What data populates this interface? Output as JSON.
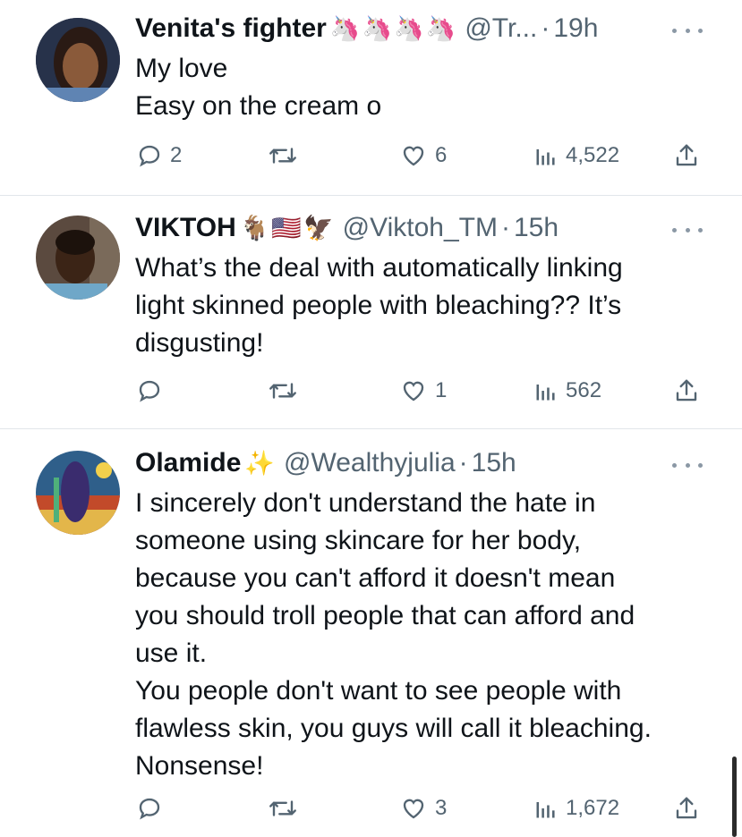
{
  "tweets": [
    {
      "name": "Venita's fighter",
      "emoji": "🦄🦄🦄🦄",
      "handle": "@Tr...",
      "time": "19h",
      "lines": [
        "My love",
        "Easy on the cream o"
      ],
      "replies": "2",
      "retweets": "",
      "likes": "6",
      "views": "4,522"
    },
    {
      "name": "VIKTOH",
      "emoji": "🐐🇺🇸🦅",
      "handle": "@Viktoh_TM",
      "time": "15h",
      "lines": [
        "What’s the deal with automatically linking",
        "light skinned people with bleaching??  It’s",
        "disgusting!"
      ],
      "replies": "",
      "retweets": "",
      "likes": "1",
      "views": "562"
    },
    {
      "name": "Olamide",
      "emoji": "✨",
      "handle": "@Wealthyjulia",
      "time": "15h",
      "lines": [
        "I sincerely don't understand the hate in",
        "someone using skincare for her body,",
        "because you can't afford it doesn't mean",
        "you should troll people that can afford and",
        "use it.",
        "You people don't want to see people with",
        "flawless skin, you guys will call it bleaching.",
        "Nonsense!"
      ],
      "replies": "",
      "retweets": "",
      "likes": "3",
      "views": "1,672"
    }
  ],
  "separator": "·",
  "icons": {
    "reply": "reply-bubble-icon",
    "retweet": "retweet-arrows-icon",
    "like": "heart-icon",
    "views": "bar-chart-icon",
    "share": "share-upload-icon",
    "more": "more-dots-icon"
  },
  "colors": {
    "text": "#0f1419",
    "secondary": "#536471",
    "divider": "#e1e6ea"
  }
}
